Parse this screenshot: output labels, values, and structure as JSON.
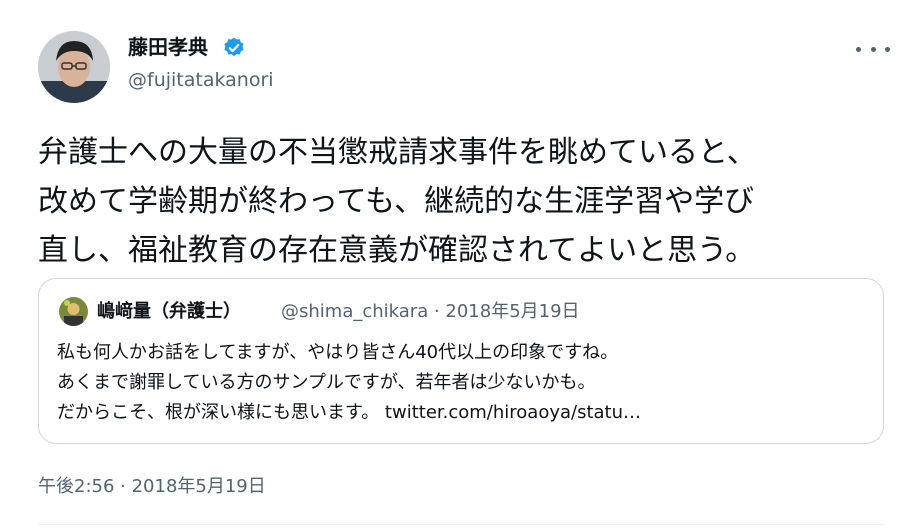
{
  "author": {
    "display_name": "藤田孝典",
    "handle": "@fujitatakanori",
    "verified": true
  },
  "tweet": {
    "lines": [
      "弁護士への大量の不当懲戒請求事件を眺めていると、",
      "改めて学齢期が終わっても、継続的な生涯学習や学び",
      "直し、福祉教育の存在意義が確認されてよいと思う。"
    ],
    "timestamp": "午後2:56 · 2018年5月19日"
  },
  "quoted_tweet": {
    "display_name": "嶋﨑量（弁護士）",
    "handle_date": "@shima_chikara · 2018年5月19日",
    "lines": [
      "私も何人かお話をしてますが、やはり皆さん40代以上の印象ですね。",
      "あくまで謝罪している方のサンプルですが、若年者は少ないかも。",
      "だからこそ、根が深い様にも思います。 twitter.com/hiroaoya/statu…"
    ]
  },
  "icons": {
    "verified": "verified-badge-icon",
    "more": "more-options-icon"
  },
  "colors": {
    "text": "#0f1419",
    "secondary": "#536471",
    "verified": "#1d9bf0",
    "border": "#cfd9de"
  }
}
